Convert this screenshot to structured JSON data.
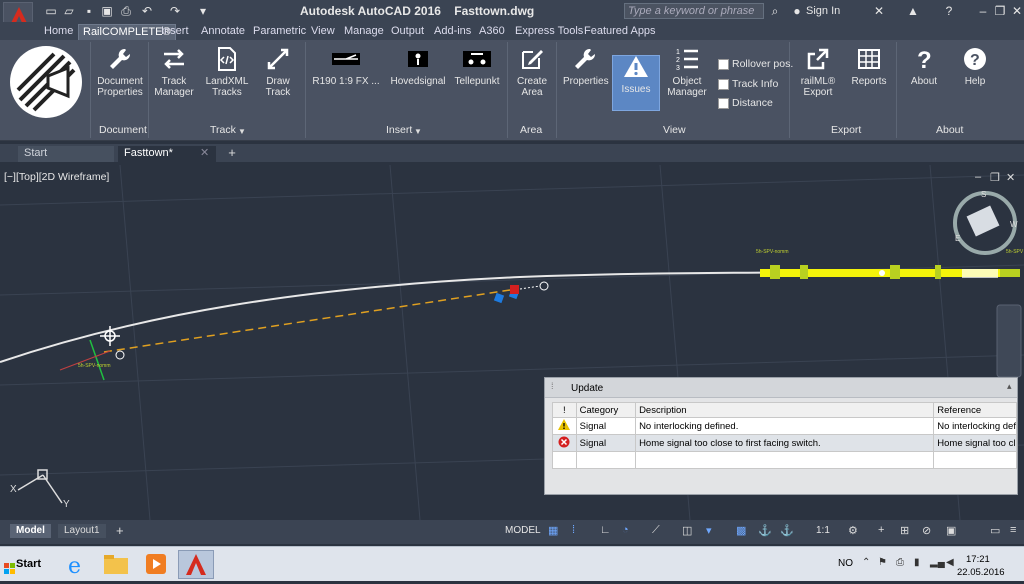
{
  "window": {
    "title": "Autodesk AutoCAD 2016    Fasttown.dwg"
  },
  "search": {
    "placeholder": "Type a keyword or phrase"
  },
  "user": {
    "sign_in": "Sign In"
  },
  "ribbon_tabs": [
    "Home",
    "RailCOMPLETE®",
    "Insert",
    "Annotate",
    "Parametric",
    "View",
    "Manage",
    "Output",
    "Add-ins",
    "A360",
    "Express Tools",
    "Featured Apps"
  ],
  "active_tab": "RailCOMPLETE®",
  "ribbon": {
    "document": {
      "title": "Document",
      "doc_props": "Document\nProperties"
    },
    "track": {
      "title": "Track",
      "track_manager": "Track\nManager",
      "landxml": "LandXML\nTracks",
      "draw_track": "Draw\nTrack"
    },
    "insert": {
      "title": "Insert",
      "r190": "R190 1:9 FX ...",
      "hovedsignal": "Hovedsignal",
      "tellepunkt": "Tellepunkt"
    },
    "area": {
      "title": "Area",
      "create_area": "Create\nArea"
    },
    "view": {
      "title": "View",
      "properties": "Properties",
      "issues": "Issues",
      "object_manager": "Object\nManager",
      "rollover": "Rollover pos.",
      "track_info": "Track Info",
      "distance": "Distance"
    },
    "export": {
      "title": "Export",
      "railml": "railML®\nExport",
      "reports": "Reports"
    },
    "about": {
      "title": "About",
      "about": "About",
      "help": "Help"
    }
  },
  "doc_tabs": [
    "Start",
    "Fasttown*"
  ],
  "viewport": {
    "label": "[−][Top][2D Wireframe]"
  },
  "issues_panel": {
    "title": "Update",
    "columns": [
      "!",
      "Category",
      "Description",
      "Reference"
    ],
    "rows": [
      {
        "severity": "warning",
        "category": "Signal",
        "description": "No interlocking defined.",
        "reference": "No interlocking def"
      },
      {
        "severity": "error",
        "category": "Signal",
        "description": "Home signal too close to first facing switch.",
        "reference": "Home signal too cl"
      }
    ]
  },
  "layout_tabs": [
    "Model",
    "Layout1"
  ],
  "status": {
    "model": "MODEL",
    "scale": "1:1"
  },
  "taskbar": {
    "start": "Start",
    "lang": "NO",
    "time": "17:21",
    "date": "22.05.2016"
  },
  "colors": {
    "accent": "#5c87c4",
    "track_highlight": "#f4f40a",
    "error": "#d42020",
    "warning": "#e8c200"
  }
}
